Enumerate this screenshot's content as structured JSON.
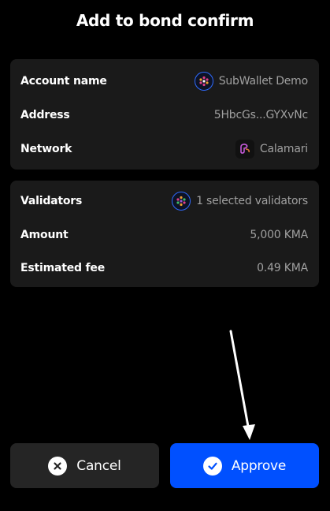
{
  "header": {
    "title": "Add to bond confirm"
  },
  "account_card": {
    "account_name_label": "Account name",
    "account_name_value": "SubWallet Demo",
    "address_label": "Address",
    "address_value": "5HbcGs...GYXvNc",
    "network_label": "Network",
    "network_value": "Calamari"
  },
  "bond_card": {
    "validators_label": "Validators",
    "validators_value": "1 selected validators",
    "amount_label": "Amount",
    "amount_value": "5,000 KMA",
    "fee_label": "Estimated fee",
    "fee_value": "0.49 KMA"
  },
  "actions": {
    "cancel_label": "Cancel",
    "approve_label": "Approve"
  },
  "colors": {
    "background": "#000000",
    "card": "#1a1a1a",
    "primary": "#0050ff",
    "secondary_button": "#252525",
    "muted_text": "#a0a0a0"
  },
  "icons": {
    "account_avatar": "account-avatar-icon",
    "network": "calamari-network-icon",
    "validator_avatar": "validator-avatar-icon",
    "cancel": "close-circle-icon",
    "approve": "check-circle-icon"
  }
}
